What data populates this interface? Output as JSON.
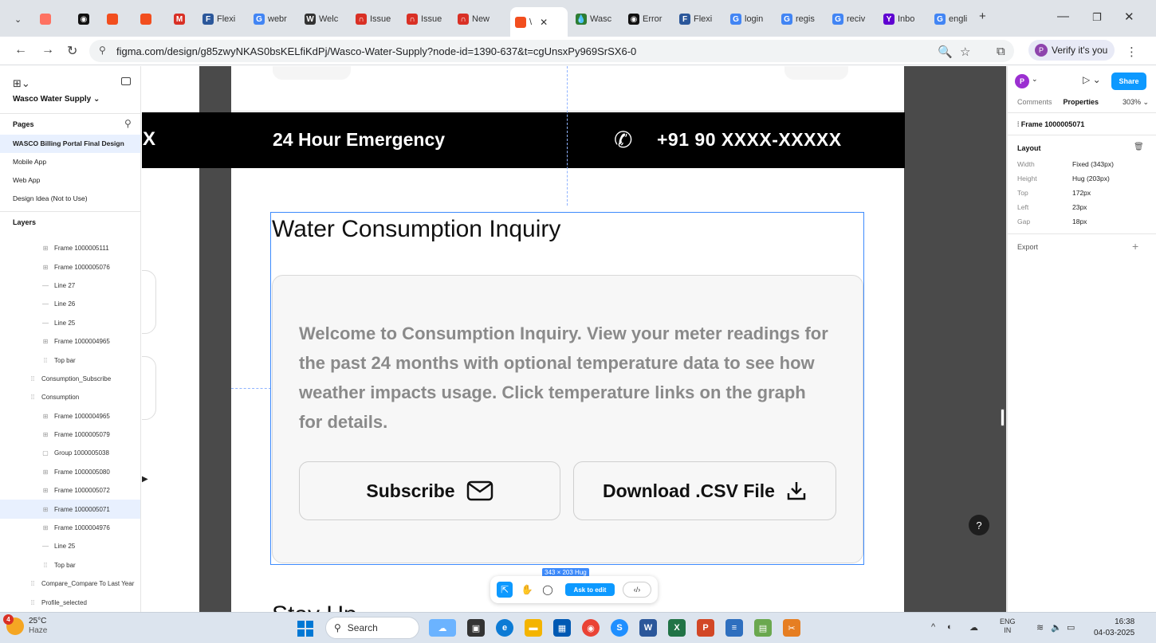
{
  "browser": {
    "tabs": [
      {
        "label": "",
        "icon": "tab-search-icon",
        "color": "#5f6368"
      },
      {
        "label": "",
        "icon": "figma-icon",
        "color": "#f24e1e"
      },
      {
        "label": "",
        "icon": "github-icon",
        "color": "#111111"
      },
      {
        "label": "",
        "icon": "figma-icon",
        "color": "#f24e1e"
      },
      {
        "label": "",
        "icon": "figma-icon",
        "color": "#f24e1e"
      },
      {
        "label": "",
        "icon": "gmail-icon",
        "color": "#d93025"
      },
      {
        "label": "Flexi",
        "icon": "flexi-icon",
        "color": "#2b579a"
      },
      {
        "label": "webr",
        "icon": "google-icon",
        "color": "#4285f4"
      },
      {
        "label": "Welc",
        "icon": "welcome-icon",
        "color": "#333333"
      },
      {
        "label": "Issue",
        "icon": "issue-icon",
        "color": "#d93025"
      },
      {
        "label": "Issue",
        "icon": "issue-icon",
        "color": "#d93025"
      },
      {
        "label": "New",
        "icon": "issue-icon",
        "color": "#d93025"
      },
      {
        "label": "\\",
        "icon": "figma-icon",
        "color": "#f24e1e"
      },
      {
        "label": "Wasc",
        "icon": "wasco-icon",
        "color": "#2e7d32"
      },
      {
        "label": "Error",
        "icon": "github-icon",
        "color": "#111111"
      },
      {
        "label": "Flexi",
        "icon": "flexi-icon",
        "color": "#2b579a"
      },
      {
        "label": "login",
        "icon": "google-icon",
        "color": "#4285f4"
      },
      {
        "label": "regis",
        "icon": "google-icon",
        "color": "#4285f4"
      },
      {
        "label": "reciv",
        "icon": "google-icon",
        "color": "#4285f4"
      },
      {
        "label": "Inbo",
        "icon": "yahoo-icon",
        "color": "#5f01d1"
      },
      {
        "label": "engli",
        "icon": "google-icon",
        "color": "#4285f4"
      }
    ],
    "url": "figma.com/design/g85zwyNKAS0bsKELfiKdPj/Wasco-Water-Supply?node-id=1390-637&t=cgUnsxPy969SrSX6-0",
    "verify_label": "Verify it's you"
  },
  "left_panel": {
    "file_name": "Wasco Water Supply",
    "pages_title": "Pages",
    "pages": [
      {
        "label": "WASCO Billing Portal Final Design",
        "selected": true
      },
      {
        "label": "Mobile App",
        "selected": false
      },
      {
        "label": "Web App",
        "selected": false
      },
      {
        "label": "Design Idea (Not to Use)",
        "selected": false
      }
    ],
    "layers_title": "Layers",
    "layers": [
      {
        "label": "Frame 1000005111",
        "icon": "frame-icon",
        "indent": 2,
        "selected": false
      },
      {
        "label": "Frame 1000005076",
        "icon": "frame-icon",
        "indent": 2,
        "selected": false
      },
      {
        "label": "Line 27",
        "icon": "line-icon",
        "indent": 2,
        "selected": false
      },
      {
        "label": "Line 26",
        "icon": "line-icon",
        "indent": 2,
        "selected": false
      },
      {
        "label": "Line 25",
        "icon": "line-icon",
        "indent": 2,
        "selected": false
      },
      {
        "label": "Frame 1000004965",
        "icon": "frame-icon",
        "indent": 2,
        "selected": false
      },
      {
        "label": "Top bar",
        "icon": "component-icon",
        "indent": 2,
        "selected": false
      },
      {
        "label": "Consumption_Subscribe",
        "icon": "component-icon",
        "indent": 1,
        "selected": false
      },
      {
        "label": "Consumption",
        "icon": "component-icon",
        "indent": 1,
        "selected": false
      },
      {
        "label": "Frame 1000004965",
        "icon": "frame-icon",
        "indent": 2,
        "selected": false
      },
      {
        "label": "Frame 1000005079",
        "icon": "frame-icon",
        "indent": 2,
        "selected": false
      },
      {
        "label": "Group 1000005038",
        "icon": "group-icon",
        "indent": 2,
        "selected": false
      },
      {
        "label": "Frame 1000005080",
        "icon": "frame-icon",
        "indent": 2,
        "selected": false
      },
      {
        "label": "Frame 1000005072",
        "icon": "frame-icon",
        "indent": 2,
        "selected": false
      },
      {
        "label": "Frame 1000005071",
        "icon": "frame-icon",
        "indent": 2,
        "selected": true
      },
      {
        "label": "Frame 1000004976",
        "icon": "frame-icon",
        "indent": 2,
        "selected": false
      },
      {
        "label": "Line 25",
        "icon": "line-icon",
        "indent": 2,
        "selected": false
      },
      {
        "label": "Top bar",
        "icon": "component-icon",
        "indent": 2,
        "selected": false
      },
      {
        "label": "Compare_Compare To Last Year",
        "icon": "component-icon",
        "indent": 1,
        "selected": false
      },
      {
        "label": "Profile_selected",
        "icon": "component-icon",
        "indent": 1,
        "selected": false
      }
    ]
  },
  "canvas": {
    "topbar_x": "X",
    "emergency": "24 Hour Emergency",
    "phone": "+91  90  XXXX-XXXXX",
    "heading": "Water Consumption Inquiry",
    "card_text": "Welcome to Consumption Inquiry. View your meter readings for the past 24 months with optional temperature data to see how weather impacts usage. Click temperature links on the graph for details.",
    "subscribe_label": "Subscribe",
    "download_label": "Download .CSV File",
    "size_tag": "343 × 203 Hug",
    "cut_heading": "Stay Up...",
    "toolbar": {
      "ask_label": "Ask to edit"
    },
    "help_label": "?"
  },
  "right_panel": {
    "avatar_letter": "P",
    "share_label": "Share",
    "tab_comments": "Comments",
    "tab_properties": "Properties",
    "zoom": "303%",
    "frame_name": "Frame 1000005071",
    "layout_title": "Layout",
    "props": [
      {
        "key": "Width",
        "value": "Fixed (343px)"
      },
      {
        "key": "Height",
        "value": "Hug (203px)"
      },
      {
        "key": "Top",
        "value": "172px"
      },
      {
        "key": "Left",
        "value": "23px"
      },
      {
        "key": "Gap",
        "value": "18px"
      }
    ],
    "export_label": "Export"
  },
  "taskbar": {
    "weather_temp": "25°C",
    "weather_desc": "Haze",
    "weather_badge": "4",
    "search_label": "Search",
    "lang": "ENG",
    "region": "IN",
    "time": "16:38",
    "date": "04-03-2025"
  },
  "colors": {
    "figma_blue": "#0d99ff",
    "selection_blue": "#3d8bfd",
    "black_bar": "#000000",
    "card_bg": "#f7f7f7"
  }
}
